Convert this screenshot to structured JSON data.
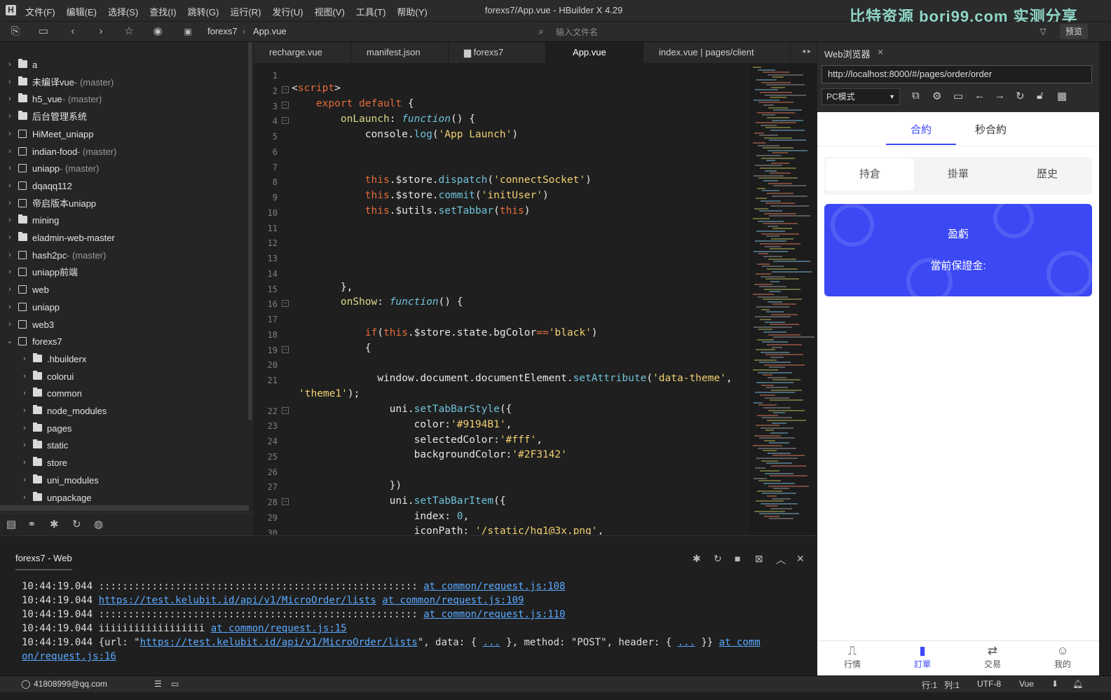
{
  "window": {
    "title": "forexs7/App.vue - HBuilder X 4.29",
    "watermark": "比特资源 bori99.com 实测分享",
    "menus": [
      "文件(F)",
      "编辑(E)",
      "选择(S)",
      "查找(I)",
      "跳转(G)",
      "运行(R)",
      "发行(U)",
      "视图(V)",
      "工具(T)",
      "帮助(Y)"
    ]
  },
  "toolbar": {
    "crumb_project": "forexs7",
    "crumb_file": "App.vue",
    "search_placeholder": "输入文件名",
    "preview_label": "预览"
  },
  "sidebar": {
    "items": [
      {
        "label": "a",
        "branch": "",
        "icon": "folder",
        "level": 0
      },
      {
        "label": "未编译vue",
        "branch": " - (master)",
        "icon": "folder",
        "level": 0
      },
      {
        "label": "h5_vue",
        "branch": " - (master)",
        "icon": "folder",
        "level": 0
      },
      {
        "label": "后台管理系统",
        "branch": "",
        "icon": "folder",
        "level": 0
      },
      {
        "label": "HiMeet_uniapp",
        "branch": "",
        "icon": "project",
        "level": 0
      },
      {
        "label": "indian-food",
        "branch": " - (master)",
        "icon": "project",
        "level": 0
      },
      {
        "label": "uniapp",
        "branch": " - (master)",
        "icon": "project",
        "level": 0
      },
      {
        "label": "dqaqq112",
        "branch": "",
        "icon": "project",
        "level": 0
      },
      {
        "label": "帝启版本uniapp",
        "branch": "",
        "icon": "project",
        "level": 0
      },
      {
        "label": "mining",
        "branch": "",
        "icon": "folder",
        "level": 0
      },
      {
        "label": "eladmin-web-master",
        "branch": "",
        "icon": "folder",
        "level": 0
      },
      {
        "label": "hash2pc",
        "branch": " - (master)",
        "icon": "project",
        "level": 0
      },
      {
        "label": "uniapp前端",
        "branch": "",
        "icon": "project",
        "level": 0
      },
      {
        "label": "web",
        "branch": "",
        "icon": "project",
        "level": 0
      },
      {
        "label": "uniapp",
        "branch": "",
        "icon": "project",
        "level": 0
      },
      {
        "label": "web3",
        "branch": "",
        "icon": "project",
        "level": 0
      },
      {
        "label": "forexs7",
        "branch": "",
        "icon": "project",
        "level": 0,
        "expanded": true
      },
      {
        "label": ".hbuilderx",
        "branch": "",
        "icon": "folder",
        "level": 1
      },
      {
        "label": "colorui",
        "branch": "",
        "icon": "folder",
        "level": 1
      },
      {
        "label": "common",
        "branch": "",
        "icon": "folder",
        "level": 1
      },
      {
        "label": "node_modules",
        "branch": "",
        "icon": "folder",
        "level": 1
      },
      {
        "label": "pages",
        "branch": "",
        "icon": "folder",
        "level": 1
      },
      {
        "label": "static",
        "branch": "",
        "icon": "folder",
        "level": 1
      },
      {
        "label": "store",
        "branch": "",
        "icon": "folder",
        "level": 1
      },
      {
        "label": "uni_modules",
        "branch": "",
        "icon": "folder",
        "level": 1
      },
      {
        "label": "unpackage",
        "branch": "",
        "icon": "folder",
        "level": 1
      }
    ]
  },
  "editor_tabs": [
    {
      "label": "recharge.vue",
      "active": false
    },
    {
      "label": "manifest.json",
      "active": false
    },
    {
      "label": "forexs7",
      "active": false,
      "icon": "folder"
    },
    {
      "label": "App.vue",
      "active": true
    },
    {
      "label": "index.vue | pages/client",
      "active": false
    }
  ],
  "editor": {
    "line_numbers": [
      "1",
      "2",
      "3",
      "4",
      "5",
      "6",
      "7",
      "8",
      "9",
      "10",
      "11",
      "12",
      "13",
      "14",
      "15",
      "16",
      "17",
      "18",
      "19",
      "20",
      "21",
      "",
      "22",
      "23",
      "24",
      "25",
      "26",
      "27",
      "28",
      "29",
      "30"
    ]
  },
  "browser": {
    "tab_label": "Web浏览器",
    "url": "http://localhost:8000/#/pages/order/order",
    "mode": "PC模式",
    "top_tabs": [
      "合約",
      "秒合約"
    ],
    "sub_tabs": [
      "持倉",
      "掛單",
      "歷史"
    ],
    "card_title": "盈虧",
    "card_subtitle": "當前保證金:",
    "nav": [
      {
        "label": "行情",
        "icon": "chart-icon"
      },
      {
        "label": "訂單",
        "icon": "order-icon"
      },
      {
        "label": "交易",
        "icon": "exchange-icon"
      },
      {
        "label": "我的",
        "icon": "user-icon"
      }
    ],
    "accent": "#3b48f3"
  },
  "console": {
    "title": "forexs7 - Web",
    "lines": [
      {
        "time": "10:44:19.044",
        "text": ":::::::::::::::::::::::::::::::::::::::::::::::::::::: ",
        "link": "at common/request.js:108"
      },
      {
        "time": "10:44:19.044",
        "text": "",
        "link_url": "https://test.kelubit.id/api/v1/MicroOrder/lists",
        "link": "at common/request.js:109"
      },
      {
        "time": "10:44:19.044",
        "text": ":::::::::::::::::::::::::::::::::::::::::::::::::::::: ",
        "link": "at common/request.js:110"
      },
      {
        "time": "10:44:19.044",
        "text": "iiiiiiiiiiiiiiiiii ",
        "link": "at common/request.js:15"
      }
    ],
    "line5_prefix": "10:44:19.044 {url: \"",
    "line5_url": "https://test.kelubit.id/api/v1/MicroOrder/lists",
    "line5_mid1": "\", data: { ",
    "line5_ell1": "...",
    "line5_mid2": " }, method: \"POST\", header: { ",
    "line5_ell2": "...",
    "line5_end": " }} ",
    "line5_link": "at comm",
    "line6_link": "on/request.js:16"
  },
  "status": {
    "user": "41808999@qq.com",
    "row": "行:1",
    "col": "列:1",
    "encoding": "UTF-8",
    "language": "Vue"
  }
}
